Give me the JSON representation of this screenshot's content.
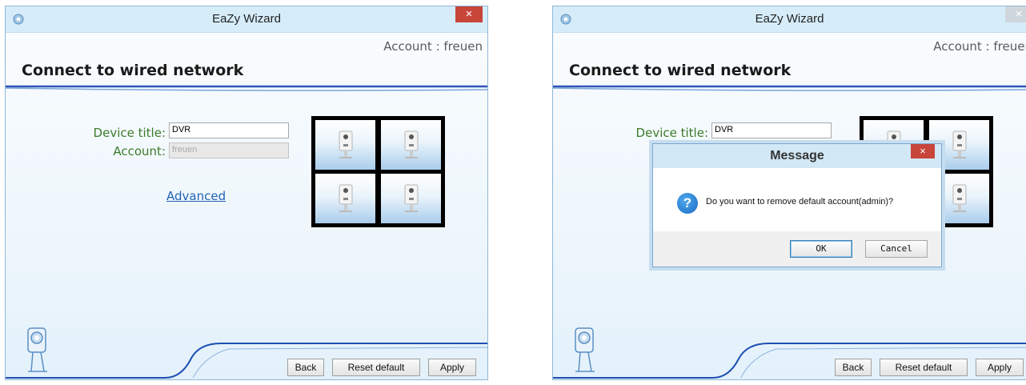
{
  "window_title": "EaZy Wizard",
  "account_line": "Account : freuen",
  "page_title": "Connect to wired network",
  "form": {
    "device_title_label": "Device title:",
    "device_title_value": "DVR",
    "account_label": "Account:",
    "account_value": "freuen"
  },
  "advanced_link": "Advanced",
  "buttons": {
    "back": "Back",
    "reset_default": "Reset default",
    "apply": "Apply"
  },
  "dialog": {
    "title": "Message",
    "message": "Do you want to remove default account(admin)?",
    "ok": "OK",
    "cancel": "Cancel",
    "icon": "question-icon"
  },
  "close_glyph": "×",
  "colors": {
    "label_green": "#3c7b2a",
    "link_blue": "#2163b4",
    "close_red": "#c8453a"
  }
}
